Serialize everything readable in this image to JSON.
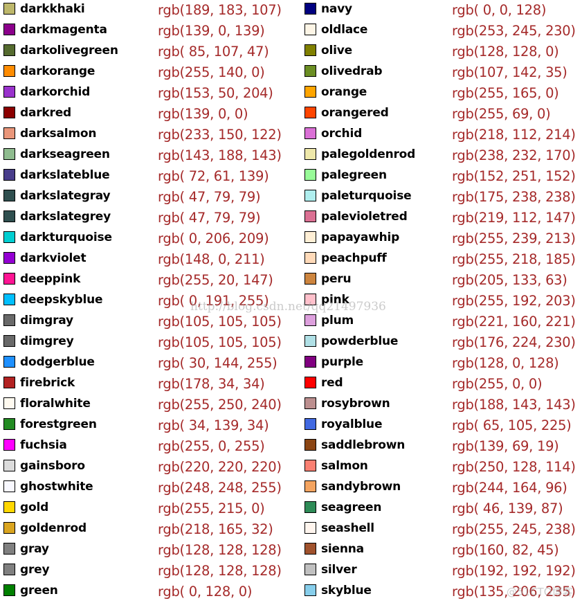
{
  "columns": [
    {
      "items": [
        {
          "name": "darkkhaki",
          "rgb": "rgb(189, 183, 107)",
          "color": "#bdb76b"
        },
        {
          "name": "darkmagenta",
          "rgb": "rgb(139, 0, 139)",
          "color": "#8b008b"
        },
        {
          "name": "darkolivegreen",
          "rgb": "rgb( 85, 107, 47)",
          "color": "#556b2f"
        },
        {
          "name": "darkorange",
          "rgb": "rgb(255, 140, 0)",
          "color": "#ff8c00"
        },
        {
          "name": "darkorchid",
          "rgb": "rgb(153, 50, 204)",
          "color": "#9932cc"
        },
        {
          "name": "darkred",
          "rgb": "rgb(139, 0, 0)",
          "color": "#8b0000"
        },
        {
          "name": "darksalmon",
          "rgb": "rgb(233, 150, 122)",
          "color": "#e9967a"
        },
        {
          "name": "darkseagreen",
          "rgb": "rgb(143, 188, 143)",
          "color": "#8fbc8f"
        },
        {
          "name": "darkslateblue",
          "rgb": "rgb( 72, 61, 139)",
          "color": "#483d8b"
        },
        {
          "name": "darkslategray",
          "rgb": "rgb( 47, 79, 79)",
          "color": "#2f4f4f"
        },
        {
          "name": "darkslategrey",
          "rgb": "rgb( 47, 79, 79)",
          "color": "#2f4f4f"
        },
        {
          "name": "darkturquoise",
          "rgb": "rgb( 0, 206, 209)",
          "color": "#00ced1"
        },
        {
          "name": "darkviolet",
          "rgb": "rgb(148, 0, 211)",
          "color": "#9400d3"
        },
        {
          "name": "deeppink",
          "rgb": "rgb(255, 20, 147)",
          "color": "#ff1493"
        },
        {
          "name": "deepskyblue",
          "rgb": "rgb( 0, 191, 255)",
          "color": "#00bfff"
        },
        {
          "name": "dimgray",
          "rgb": "rgb(105, 105, 105)",
          "color": "#696969"
        },
        {
          "name": "dimgrey",
          "rgb": "rgb(105, 105, 105)",
          "color": "#696969"
        },
        {
          "name": "dodgerblue",
          "rgb": "rgb( 30, 144, 255)",
          "color": "#1e90ff"
        },
        {
          "name": "firebrick",
          "rgb": "rgb(178, 34, 34)",
          "color": "#b22222"
        },
        {
          "name": "floralwhite",
          "rgb": "rgb(255, 250, 240)",
          "color": "#fffaf0"
        },
        {
          "name": "forestgreen",
          "rgb": "rgb( 34, 139, 34)",
          "color": "#228b22"
        },
        {
          "name": "fuchsia",
          "rgb": "rgb(255, 0, 255)",
          "color": "#ff00ff"
        },
        {
          "name": "gainsboro",
          "rgb": "rgb(220, 220, 220)",
          "color": "#dcdcdc"
        },
        {
          "name": "ghostwhite",
          "rgb": "rgb(248, 248, 255)",
          "color": "#f8f8ff"
        },
        {
          "name": "gold",
          "rgb": "rgb(255, 215, 0)",
          "color": "#ffd700"
        },
        {
          "name": "goldenrod",
          "rgb": "rgb(218, 165, 32)",
          "color": "#daa520"
        },
        {
          "name": "gray",
          "rgb": "rgb(128, 128, 128)",
          "color": "#808080"
        },
        {
          "name": "grey",
          "rgb": "rgb(128, 128, 128)",
          "color": "#808080"
        },
        {
          "name": "green",
          "rgb": "rgb( 0, 128, 0)",
          "color": "#008000"
        }
      ]
    },
    {
      "items": [
        {
          "name": "navy",
          "rgb": "rgb( 0, 0, 128)",
          "color": "#000080"
        },
        {
          "name": "oldlace",
          "rgb": "rgb(253, 245, 230)",
          "color": "#fdf5e6"
        },
        {
          "name": "olive",
          "rgb": "rgb(128, 128, 0)",
          "color": "#808000"
        },
        {
          "name": "olivedrab",
          "rgb": "rgb(107, 142, 35)",
          "color": "#6b8e23"
        },
        {
          "name": "orange",
          "rgb": "rgb(255, 165, 0)",
          "color": "#ffa500"
        },
        {
          "name": "orangered",
          "rgb": "rgb(255, 69, 0)",
          "color": "#ff4500"
        },
        {
          "name": "orchid",
          "rgb": "rgb(218, 112, 214)",
          "color": "#da70d6"
        },
        {
          "name": "palegoldenrod",
          "rgb": "rgb(238, 232, 170)",
          "color": "#eee8aa"
        },
        {
          "name": "palegreen",
          "rgb": "rgb(152, 251, 152)",
          "color": "#98fb98"
        },
        {
          "name": "paleturquoise",
          "rgb": "rgb(175, 238, 238)",
          "color": "#afeeee"
        },
        {
          "name": "palevioletred",
          "rgb": "rgb(219, 112, 147)",
          "color": "#db7093"
        },
        {
          "name": "papayawhip",
          "rgb": "rgb(255, 239, 213)",
          "color": "#ffefd5"
        },
        {
          "name": "peachpuff",
          "rgb": "rgb(255, 218, 185)",
          "color": "#ffdab9"
        },
        {
          "name": "peru",
          "rgb": "rgb(205, 133, 63)",
          "color": "#cd853f"
        },
        {
          "name": "pink",
          "rgb": "rgb(255, 192, 203)",
          "color": "#ffc0cb"
        },
        {
          "name": "plum",
          "rgb": "rgb(221, 160, 221)",
          "color": "#dda0dd"
        },
        {
          "name": "powderblue",
          "rgb": "rgb(176, 224, 230)",
          "color": "#b0e0e6"
        },
        {
          "name": "purple",
          "rgb": "rgb(128, 0, 128)",
          "color": "#800080"
        },
        {
          "name": "red",
          "rgb": "rgb(255, 0, 0)",
          "color": "#ff0000"
        },
        {
          "name": "rosybrown",
          "rgb": "rgb(188, 143, 143)",
          "color": "#bc8f8f"
        },
        {
          "name": "royalblue",
          "rgb": "rgb( 65, 105, 225)",
          "color": "#4169e1"
        },
        {
          "name": "saddlebrown",
          "rgb": "rgb(139, 69, 19)",
          "color": "#8b4513"
        },
        {
          "name": "salmon",
          "rgb": "rgb(250, 128, 114)",
          "color": "#fa8072"
        },
        {
          "name": "sandybrown",
          "rgb": "rgb(244, 164, 96)",
          "color": "#f4a460"
        },
        {
          "name": "seagreen",
          "rgb": "rgb( 46, 139, 87)",
          "color": "#2e8b57"
        },
        {
          "name": "seashell",
          "rgb": "rgb(255, 245, 238)",
          "color": "#fff5ee"
        },
        {
          "name": "sienna",
          "rgb": "rgb(160, 82, 45)",
          "color": "#a0522d"
        },
        {
          "name": "silver",
          "rgb": "rgb(192, 192, 192)",
          "color": "#c0c0c0"
        },
        {
          "name": "skyblue",
          "rgb": "rgb(135, 206, 235)",
          "color": "#87ceeb"
        }
      ]
    }
  ],
  "watermark": "http://blog.csdn.net/qq21497936",
  "watermark2": "@51CTO博客"
}
